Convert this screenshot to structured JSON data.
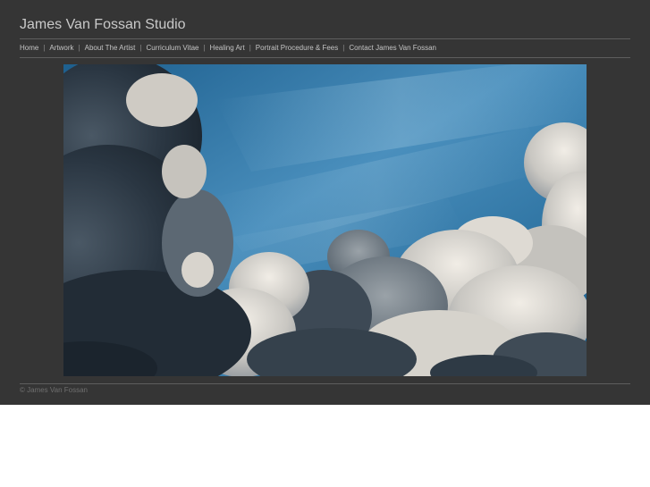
{
  "site": {
    "title": "James Van Fossan Studio"
  },
  "nav": {
    "separator": "|",
    "items": [
      {
        "label": "Home"
      },
      {
        "label": "Artwork"
      },
      {
        "label": "About The Artist"
      },
      {
        "label": "Curriculum Vitae"
      },
      {
        "label": "Healing Art"
      },
      {
        "label": "Portrait Procedure & Fees"
      },
      {
        "label": "Contact James Van Fossan"
      }
    ]
  },
  "colors": {
    "panel": "#353535",
    "title_text": "#c9c9c9",
    "nav_text": "#c4c4c4",
    "footer_text": "#6f6f6f",
    "rule": "#5e5e5e",
    "sky_light": "#4a8fbd",
    "sky_deep": "#175c8b",
    "cloud_dark": "#1f2a35",
    "cloud_light": "#e8e4dc"
  },
  "footer": {
    "copyright": "© James Van Fossan"
  }
}
